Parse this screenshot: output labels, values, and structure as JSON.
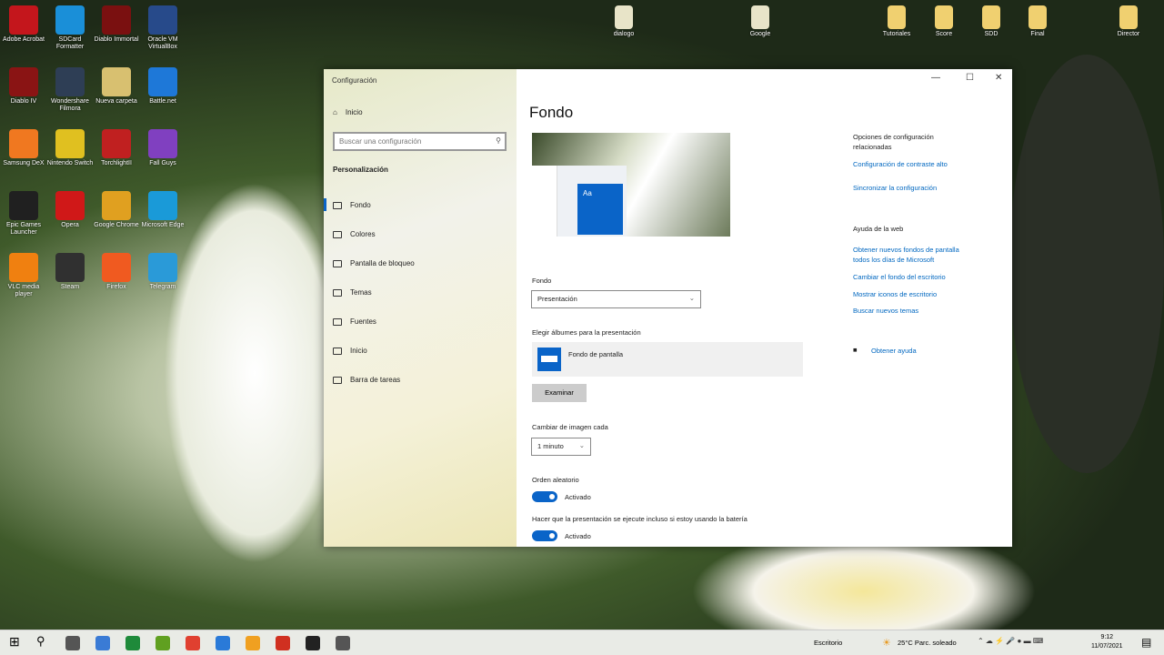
{
  "desktop": {
    "icons_left": [
      "Adobe Acrobat",
      "SDCard Formatter",
      "Diablo Immortal",
      "Oracle VM VirtualBox",
      "Diablo IV",
      "Wondershare Filmora",
      "Nueva carpeta",
      "Battle.net",
      "Samsung DeX",
      "Nintendo Switch",
      "TorchlightII",
      "Fall Guys",
      "Epic Games Launcher",
      "Opera",
      "Google Chrome",
      "Microsoft Edge",
      "VLC media player",
      "Steam",
      "Firefox",
      "Telegram"
    ],
    "icons_top": [
      "dialogo",
      "Google",
      "Tutoriales",
      "Score",
      "SDD",
      "Final",
      "Director"
    ]
  },
  "window": {
    "app_title": "Configuración",
    "minimize": "—",
    "maximize": "☐",
    "close": "✕"
  },
  "sidebar": {
    "home": "Inicio",
    "search_placeholder": "Buscar una configuración",
    "section": "Personalización",
    "items": [
      {
        "label": "Fondo"
      },
      {
        "label": "Colores"
      },
      {
        "label": "Pantalla de bloqueo"
      },
      {
        "label": "Temas"
      },
      {
        "label": "Fuentes"
      },
      {
        "label": "Inicio"
      },
      {
        "label": "Barra de tareas"
      }
    ]
  },
  "main": {
    "title": "Fondo",
    "preview_tile": "Aa",
    "background_label": "Fondo",
    "background_value": "Presentación",
    "albums_label": "Elegir álbumes para la presentación",
    "album_name": "Fondo de pantalla",
    "browse": "Examinar",
    "interval_label": "Cambiar de imagen cada",
    "interval_value": "1 minuto",
    "shuffle_label": "Orden aleatorio",
    "shuffle_state": "Activado",
    "battery_label": "Hacer que la presentación se ejecute incluso si estoy usando la batería",
    "battery_state": "Activado"
  },
  "related": {
    "heading": "Opciones de configuración relacionadas",
    "links": [
      "Configuración de contraste alto",
      "Sincronizar la configuración"
    ],
    "web_heading": "Ayuda de la web",
    "web_links": [
      "Obtener nuevos fondos de pantalla todos los días de Microsoft",
      "Cambiar el fondo del escritorio",
      "Mostrar iconos de escritorio",
      "Buscar nuevos temas"
    ],
    "help": "Obtener ayuda"
  },
  "taskbar": {
    "desktop_label": "Escritorio",
    "weather": "25°C  Parc. soleado",
    "time": "9:12",
    "date": "11/07/2021"
  },
  "colors": {
    "accent": "#0a64c8",
    "link": "#0067c0"
  }
}
